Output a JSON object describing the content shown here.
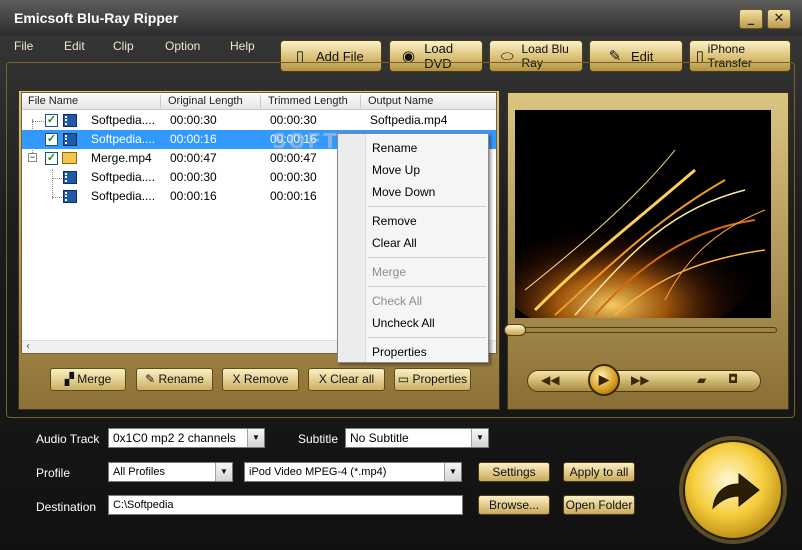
{
  "app": {
    "title": "Emicsoft Blu-Ray Ripper"
  },
  "window_buttons": {
    "minimize": "_",
    "close": "✕"
  },
  "menu": [
    "File",
    "Edit",
    "Clip",
    "Option",
    "Help"
  ],
  "toolbar": [
    {
      "label": "Add File",
      "icon": "add-file-icon"
    },
    {
      "label": "Load DVD",
      "icon": "dvd-icon"
    },
    {
      "label": "Load Blu Ray",
      "icon": "blu-ray-icon"
    },
    {
      "label": "Edit",
      "icon": "edit-icon"
    },
    {
      "label": "iPhone Transfer",
      "icon": "iphone-icon"
    }
  ],
  "file_list": {
    "columns": [
      "File Name",
      "Original Length",
      "Trimmed Length",
      "Output Name"
    ],
    "rows": [
      {
        "name": "Softpedia....",
        "original": "00:00:30",
        "trimmed": "00:00:30",
        "output": "Softpedia.mp4",
        "checked": true,
        "type": "video",
        "selected": false
      },
      {
        "name": "Softpedia....",
        "original": "00:00:16",
        "trimmed": "00:00:16",
        "output": "",
        "checked": true,
        "type": "video",
        "selected": true
      },
      {
        "name": "Merge.mp4",
        "original": "00:00:47",
        "trimmed": "00:00:47",
        "output": "",
        "checked": true,
        "type": "folder",
        "selected": false
      },
      {
        "name": "Softpedia....",
        "original": "00:00:30",
        "trimmed": "00:00:30",
        "output": "",
        "checked": false,
        "type": "video",
        "selected": false
      },
      {
        "name": "Softpedia....",
        "original": "00:00:16",
        "trimmed": "00:00:16",
        "output": "",
        "checked": false,
        "type": "video",
        "selected": false
      }
    ]
  },
  "context_menu": [
    {
      "label": "Rename",
      "disabled": false
    },
    {
      "label": "Move Up",
      "disabled": false
    },
    {
      "label": "Move Down",
      "disabled": false
    },
    {
      "label": "Remove",
      "disabled": false
    },
    {
      "label": "Clear All",
      "disabled": false
    },
    {
      "label": "Merge",
      "disabled": true
    },
    {
      "label": "Check All",
      "disabled": true
    },
    {
      "label": "Uncheck All",
      "disabled": false
    },
    {
      "label": "Properties",
      "disabled": false
    }
  ],
  "list_buttons": [
    "Merge",
    "Rename",
    "Remove",
    "Clear all",
    "Properties"
  ],
  "list_button_glyphs": [
    "▞",
    "✎",
    "X",
    "X",
    "▭"
  ],
  "watermark": "SOFTPEDIA",
  "player": {
    "controls": [
      "rewind",
      "play",
      "fast-forward",
      "open-folder",
      "snapshot"
    ],
    "progress": 0
  },
  "settings": {
    "audio_track_label": "Audio Track",
    "audio_track_value": "0x1C0 mp2 2 channels",
    "subtitle_label": "Subtitle",
    "subtitle_value": "No Subtitle",
    "profile_label": "Profile",
    "profile_category": "All Profiles",
    "profile_value": "iPod Video MPEG-4 (*.mp4)",
    "settings_button": "Settings",
    "apply_all_button": "Apply to all",
    "destination_label": "Destination",
    "destination_value": "C:\\Softpedia",
    "browse_button": "Browse...",
    "open_folder_button": "Open Folder"
  },
  "colors": {
    "gold": "#d8c27e",
    "dark_bg": "#1d1d1d",
    "selection": "#3399ff"
  }
}
